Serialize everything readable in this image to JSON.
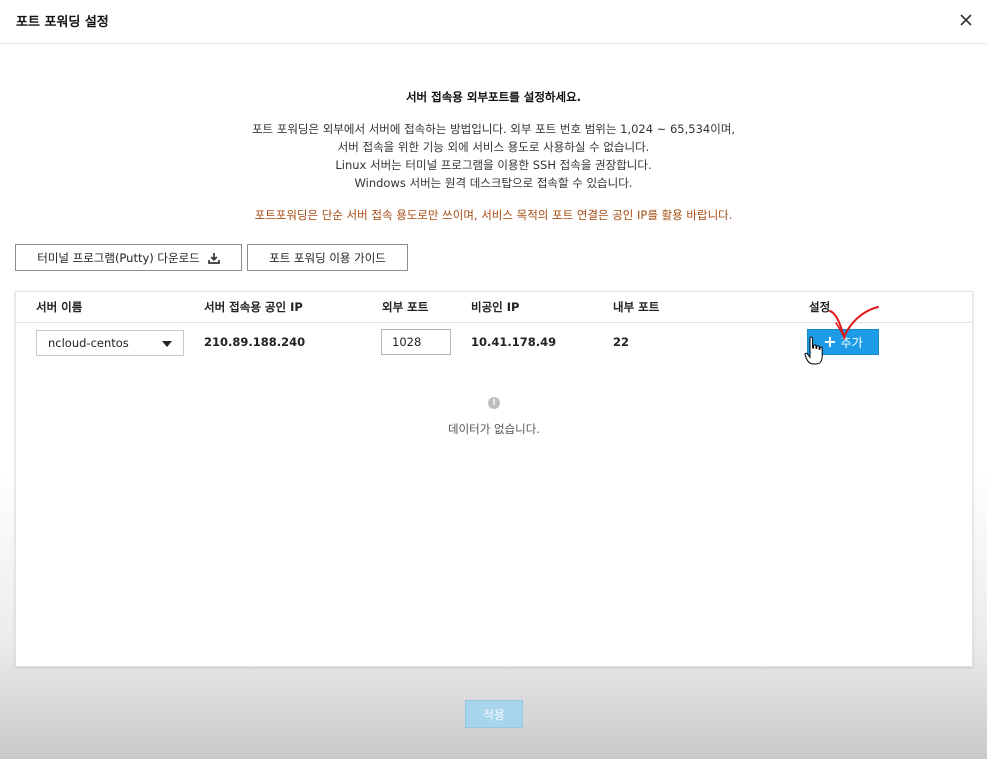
{
  "dialog": {
    "title": "포트 포워딩 설정"
  },
  "intro": {
    "headline": "서버 접속용 외부포트를 설정하세요.",
    "lines": [
      "포트 포워딩은 외부에서 서버에 접속하는 방법입니다. 외부 포트 번호 범위는 1,024 ~ 65,534이며,",
      "서버 접속을 위한 기능 외에 서비스 용도로 사용하실 수 없습니다.",
      "Linux 서버는 터미널 프로그램을 이용한 SSH 접속을 권장합니다.",
      "Windows 서버는 원격 데스크탑으로 접속할 수 있습니다."
    ],
    "warning": "포트포워딩은 단순 서버 접속 용도로만 쓰이며, 서비스 목적의 포트 연결은 공인 IP를 활용 바랍니다."
  },
  "buttons": {
    "download": "터미널 프로그램(Putty) 다운로드",
    "guide": "포트 포워딩 이용 가이드"
  },
  "table": {
    "headers": {
      "server_name": "서버 이름",
      "public_ip": "서버 접속용 공인 IP",
      "external_port": "외부 포트",
      "private_ip": "비공인 IP",
      "internal_port": "내부 포트",
      "settings": "설정"
    },
    "row": {
      "server_name": "ncloud-centos",
      "public_ip": "210.89.188.240",
      "external_port": "1028",
      "private_ip": "10.41.178.49",
      "internal_port": "22",
      "add_label": "추가",
      "add_symbol": "+"
    },
    "empty": {
      "icon": "info-icon",
      "text": "데이터가 없습니다."
    }
  },
  "footer": {
    "apply": "적용"
  },
  "colors": {
    "add_button": "#1e9be6",
    "apply_disabled": "#a8d4ec",
    "warning_text": "#a64b12",
    "annotation": "#e0191a"
  }
}
